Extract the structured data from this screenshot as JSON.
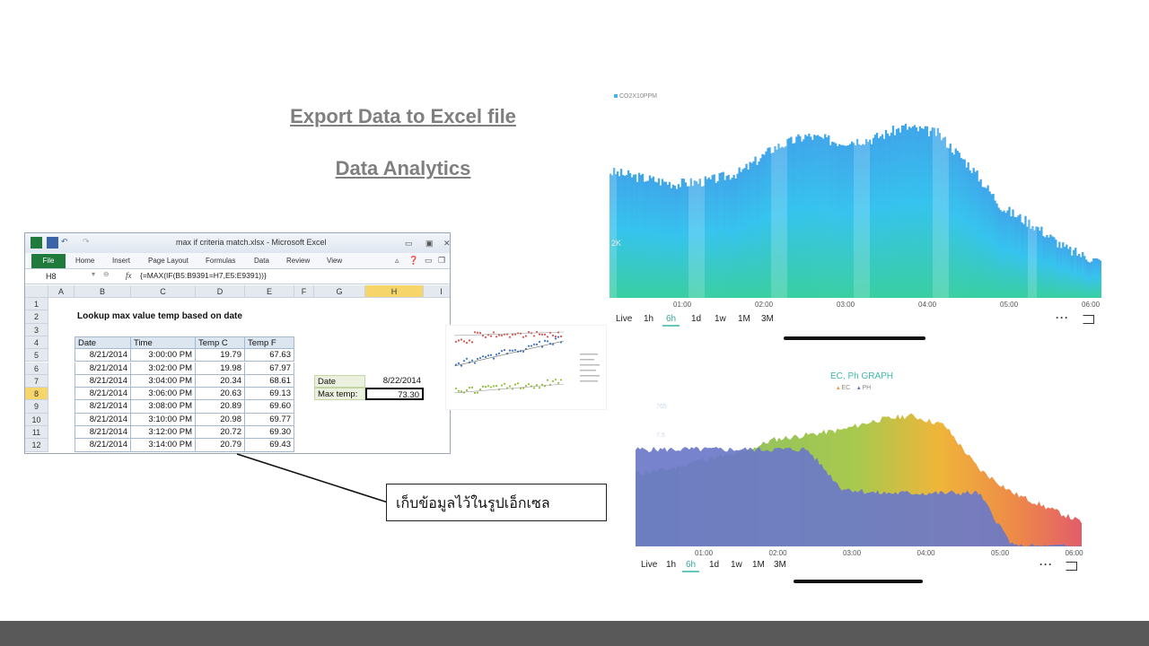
{
  "slide": {
    "heading1": "Export Data to Excel file",
    "heading2": "Data Analytics",
    "callout": "เก็บข้อมูลไว้ในรูปเอ็กเซล",
    "footer_color": "#595959"
  },
  "excel": {
    "window_title": "max if criteria match.xlsx  -  Microsoft Excel",
    "ribbon_tabs": [
      "File",
      "Home",
      "Insert",
      "Page Layout",
      "Formulas",
      "Data",
      "Review",
      "View"
    ],
    "name_box": "H8",
    "fx_label": "fx",
    "formula": "{=MAX(IF(B5:B9391=H7,E5:E9391))}",
    "columns": [
      "A",
      "B",
      "C",
      "D",
      "E",
      "F",
      "G",
      "H",
      "I"
    ],
    "rows": [
      "1",
      "2",
      "3",
      "4",
      "5",
      "6",
      "7",
      "8",
      "9",
      "10",
      "11",
      "12"
    ],
    "sheet_title": "Lookup max value temp based on date",
    "table_headers": [
      "Date",
      "Time",
      "Temp C",
      "Temp F"
    ],
    "table_rows": [
      [
        "8/21/2014",
        "3:00:00 PM",
        "19.79",
        "67.63"
      ],
      [
        "8/21/2014",
        "3:02:00 PM",
        "19.98",
        "67.97"
      ],
      [
        "8/21/2014",
        "3:04:00 PM",
        "20.34",
        "68.61"
      ],
      [
        "8/21/2014",
        "3:06:00 PM",
        "20.63",
        "69.13"
      ],
      [
        "8/21/2014",
        "3:08:00 PM",
        "20.89",
        "69.60"
      ],
      [
        "8/21/2014",
        "3:10:00 PM",
        "20.98",
        "69.77"
      ],
      [
        "8/21/2014",
        "3:12:00 PM",
        "20.72",
        "69.30"
      ],
      [
        "8/21/2014",
        "3:14:00 PM",
        "20.79",
        "69.43"
      ]
    ],
    "lookup": {
      "date_label": "Date",
      "date_value": "8/22/2014",
      "max_label": "Max temp:",
      "max_value": "73.30"
    },
    "active_cell_color": "#f6d66a"
  },
  "co2_chart": {
    "legend": "CO2X10PPM",
    "y_label": "2K",
    "time_ticks": [
      "01:00",
      "02:00",
      "03:00",
      "04:00",
      "05:00",
      "06:00"
    ],
    "ranges": [
      "Live",
      "1h",
      "6h",
      "1d",
      "1w",
      "1M",
      "3M"
    ],
    "active_range": "6h",
    "gradient_top": "#3fb6ef",
    "gradient_bottom": "#3ccfa3"
  },
  "ecph_chart": {
    "title": "EC, Ph GRAPH",
    "legend": [
      "EC",
      "PH"
    ],
    "y_labels": [
      "765",
      "7.5"
    ],
    "time_ticks": [
      "01:00",
      "02:00",
      "03:00",
      "04:00",
      "05:00",
      "06:00"
    ],
    "ranges": [
      "Live",
      "1h",
      "6h",
      "1d",
      "1w",
      "1M",
      "3M"
    ],
    "active_range": "6h",
    "ph_color": "#6b78c8"
  },
  "chart_data": [
    {
      "type": "area",
      "series": [
        {
          "name": "CO2X10PPM",
          "values": [
            2.1,
            2.0,
            1.9,
            1.95,
            2.1,
            2.5,
            2.7,
            2.6,
            2.65,
            2.85,
            2.75,
            2.2,
            1.5,
            1.2,
            0.8,
            0.6
          ]
        }
      ],
      "x": [
        "00:25",
        "00:45",
        "01:05",
        "01:25",
        "01:45",
        "02:05",
        "02:25",
        "02:45",
        "03:05",
        "03:25",
        "03:45",
        "04:05",
        "04:25",
        "04:45",
        "05:25",
        "06:00"
      ]
    },
    {
      "type": "area",
      "series": [
        {
          "name": "EC",
          "values": [
            1.5,
            1.6,
            1.8,
            1.9,
            2.2,
            2.3,
            2.4,
            2.6,
            2.7,
            2.5,
            1.6,
            1.1,
            0.8,
            0.5
          ]
        },
        {
          "name": "PH",
          "values": [
            2.0,
            2.0,
            2.0,
            2.0,
            2.0,
            2.0,
            1.2,
            1.1,
            1.1,
            1.1,
            1.1,
            0.0,
            0.0,
            0.0
          ]
        }
      ],
      "x": [
        "00:20",
        "00:40",
        "01:00",
        "01:20",
        "01:40",
        "02:00",
        "02:20",
        "02:40",
        "03:20",
        "04:00",
        "04:30",
        "05:00",
        "05:30",
        "06:00"
      ]
    }
  ]
}
